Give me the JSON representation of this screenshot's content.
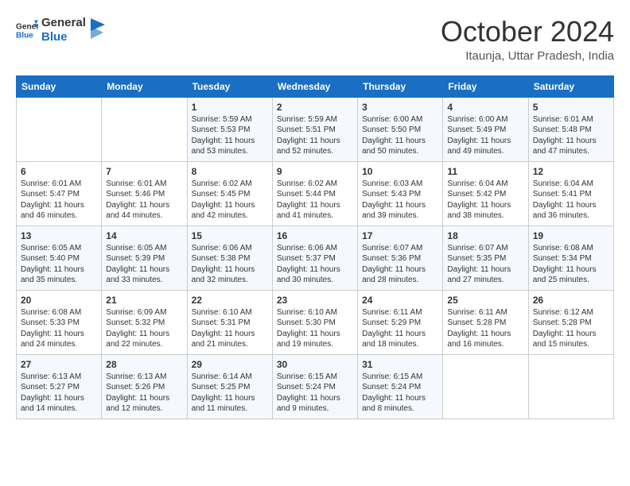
{
  "header": {
    "logo_general": "General",
    "logo_blue": "Blue",
    "month_title": "October 2024",
    "subtitle": "Itaunja, Uttar Pradesh, India"
  },
  "days_of_week": [
    "Sunday",
    "Monday",
    "Tuesday",
    "Wednesday",
    "Thursday",
    "Friday",
    "Saturday"
  ],
  "weeks": [
    [
      {
        "day": "",
        "content": ""
      },
      {
        "day": "",
        "content": ""
      },
      {
        "day": "1",
        "content": "Sunrise: 5:59 AM\nSunset: 5:53 PM\nDaylight: 11 hours and 53 minutes."
      },
      {
        "day": "2",
        "content": "Sunrise: 5:59 AM\nSunset: 5:51 PM\nDaylight: 11 hours and 52 minutes."
      },
      {
        "day": "3",
        "content": "Sunrise: 6:00 AM\nSunset: 5:50 PM\nDaylight: 11 hours and 50 minutes."
      },
      {
        "day": "4",
        "content": "Sunrise: 6:00 AM\nSunset: 5:49 PM\nDaylight: 11 hours and 49 minutes."
      },
      {
        "day": "5",
        "content": "Sunrise: 6:01 AM\nSunset: 5:48 PM\nDaylight: 11 hours and 47 minutes."
      }
    ],
    [
      {
        "day": "6",
        "content": "Sunrise: 6:01 AM\nSunset: 5:47 PM\nDaylight: 11 hours and 46 minutes."
      },
      {
        "day": "7",
        "content": "Sunrise: 6:01 AM\nSunset: 5:46 PM\nDaylight: 11 hours and 44 minutes."
      },
      {
        "day": "8",
        "content": "Sunrise: 6:02 AM\nSunset: 5:45 PM\nDaylight: 11 hours and 42 minutes."
      },
      {
        "day": "9",
        "content": "Sunrise: 6:02 AM\nSunset: 5:44 PM\nDaylight: 11 hours and 41 minutes."
      },
      {
        "day": "10",
        "content": "Sunrise: 6:03 AM\nSunset: 5:43 PM\nDaylight: 11 hours and 39 minutes."
      },
      {
        "day": "11",
        "content": "Sunrise: 6:04 AM\nSunset: 5:42 PM\nDaylight: 11 hours and 38 minutes."
      },
      {
        "day": "12",
        "content": "Sunrise: 6:04 AM\nSunset: 5:41 PM\nDaylight: 11 hours and 36 minutes."
      }
    ],
    [
      {
        "day": "13",
        "content": "Sunrise: 6:05 AM\nSunset: 5:40 PM\nDaylight: 11 hours and 35 minutes."
      },
      {
        "day": "14",
        "content": "Sunrise: 6:05 AM\nSunset: 5:39 PM\nDaylight: 11 hours and 33 minutes."
      },
      {
        "day": "15",
        "content": "Sunrise: 6:06 AM\nSunset: 5:38 PM\nDaylight: 11 hours and 32 minutes."
      },
      {
        "day": "16",
        "content": "Sunrise: 6:06 AM\nSunset: 5:37 PM\nDaylight: 11 hours and 30 minutes."
      },
      {
        "day": "17",
        "content": "Sunrise: 6:07 AM\nSunset: 5:36 PM\nDaylight: 11 hours and 28 minutes."
      },
      {
        "day": "18",
        "content": "Sunrise: 6:07 AM\nSunset: 5:35 PM\nDaylight: 11 hours and 27 minutes."
      },
      {
        "day": "19",
        "content": "Sunrise: 6:08 AM\nSunset: 5:34 PM\nDaylight: 11 hours and 25 minutes."
      }
    ],
    [
      {
        "day": "20",
        "content": "Sunrise: 6:08 AM\nSunset: 5:33 PM\nDaylight: 11 hours and 24 minutes."
      },
      {
        "day": "21",
        "content": "Sunrise: 6:09 AM\nSunset: 5:32 PM\nDaylight: 11 hours and 22 minutes."
      },
      {
        "day": "22",
        "content": "Sunrise: 6:10 AM\nSunset: 5:31 PM\nDaylight: 11 hours and 21 minutes."
      },
      {
        "day": "23",
        "content": "Sunrise: 6:10 AM\nSunset: 5:30 PM\nDaylight: 11 hours and 19 minutes."
      },
      {
        "day": "24",
        "content": "Sunrise: 6:11 AM\nSunset: 5:29 PM\nDaylight: 11 hours and 18 minutes."
      },
      {
        "day": "25",
        "content": "Sunrise: 6:11 AM\nSunset: 5:28 PM\nDaylight: 11 hours and 16 minutes."
      },
      {
        "day": "26",
        "content": "Sunrise: 6:12 AM\nSunset: 5:28 PM\nDaylight: 11 hours and 15 minutes."
      }
    ],
    [
      {
        "day": "27",
        "content": "Sunrise: 6:13 AM\nSunset: 5:27 PM\nDaylight: 11 hours and 14 minutes."
      },
      {
        "day": "28",
        "content": "Sunrise: 6:13 AM\nSunset: 5:26 PM\nDaylight: 11 hours and 12 minutes."
      },
      {
        "day": "29",
        "content": "Sunrise: 6:14 AM\nSunset: 5:25 PM\nDaylight: 11 hours and 11 minutes."
      },
      {
        "day": "30",
        "content": "Sunrise: 6:15 AM\nSunset: 5:24 PM\nDaylight: 11 hours and 9 minutes."
      },
      {
        "day": "31",
        "content": "Sunrise: 6:15 AM\nSunset: 5:24 PM\nDaylight: 11 hours and 8 minutes."
      },
      {
        "day": "",
        "content": ""
      },
      {
        "day": "",
        "content": ""
      }
    ]
  ]
}
